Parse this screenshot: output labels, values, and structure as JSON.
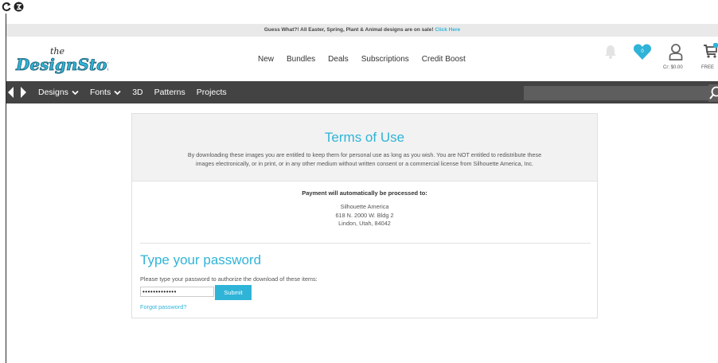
{
  "promo": {
    "text": "Guess What?! All Easter, Spring, Plant & Animal designs are on sale!",
    "link": "Click Here"
  },
  "header": {
    "logo_alt": "the DesignStore",
    "nav": [
      "New",
      "Bundles",
      "Deals",
      "Subscriptions",
      "Credit Boost"
    ],
    "favorites_count": "0",
    "credit": "Cr: $0.00",
    "cart_label": "FREE"
  },
  "catnav": {
    "items": [
      "Designs",
      "Fonts",
      "3D",
      "Patterns",
      "Projects"
    ],
    "search_placeholder": ""
  },
  "terms": {
    "title": "Terms of Use",
    "body_line1": "By downloading these images you are entitled to keep them for personal use as long as you wish. You are NOT entitled to redistribute these",
    "body_line2": "images electronically, or in print, or in any other medium without written consent or a commercial license from Silhouette America, Inc."
  },
  "payment": {
    "heading": "Payment will automatically be processed to:",
    "name": "Silhouette America",
    "street": "618 N. 2000 W. Bldg 2",
    "city": "Lindon, Utah, 84042"
  },
  "password": {
    "title": "Type your password",
    "description": "Please type your password to authorize the download of these items:",
    "value": "•••••••••••••",
    "submit_label": "Submit",
    "forgot_label": "Forgot password?"
  },
  "colors": {
    "accent": "#2fb4d8",
    "navbar": "#434343",
    "banner": "#e9e9e9"
  }
}
